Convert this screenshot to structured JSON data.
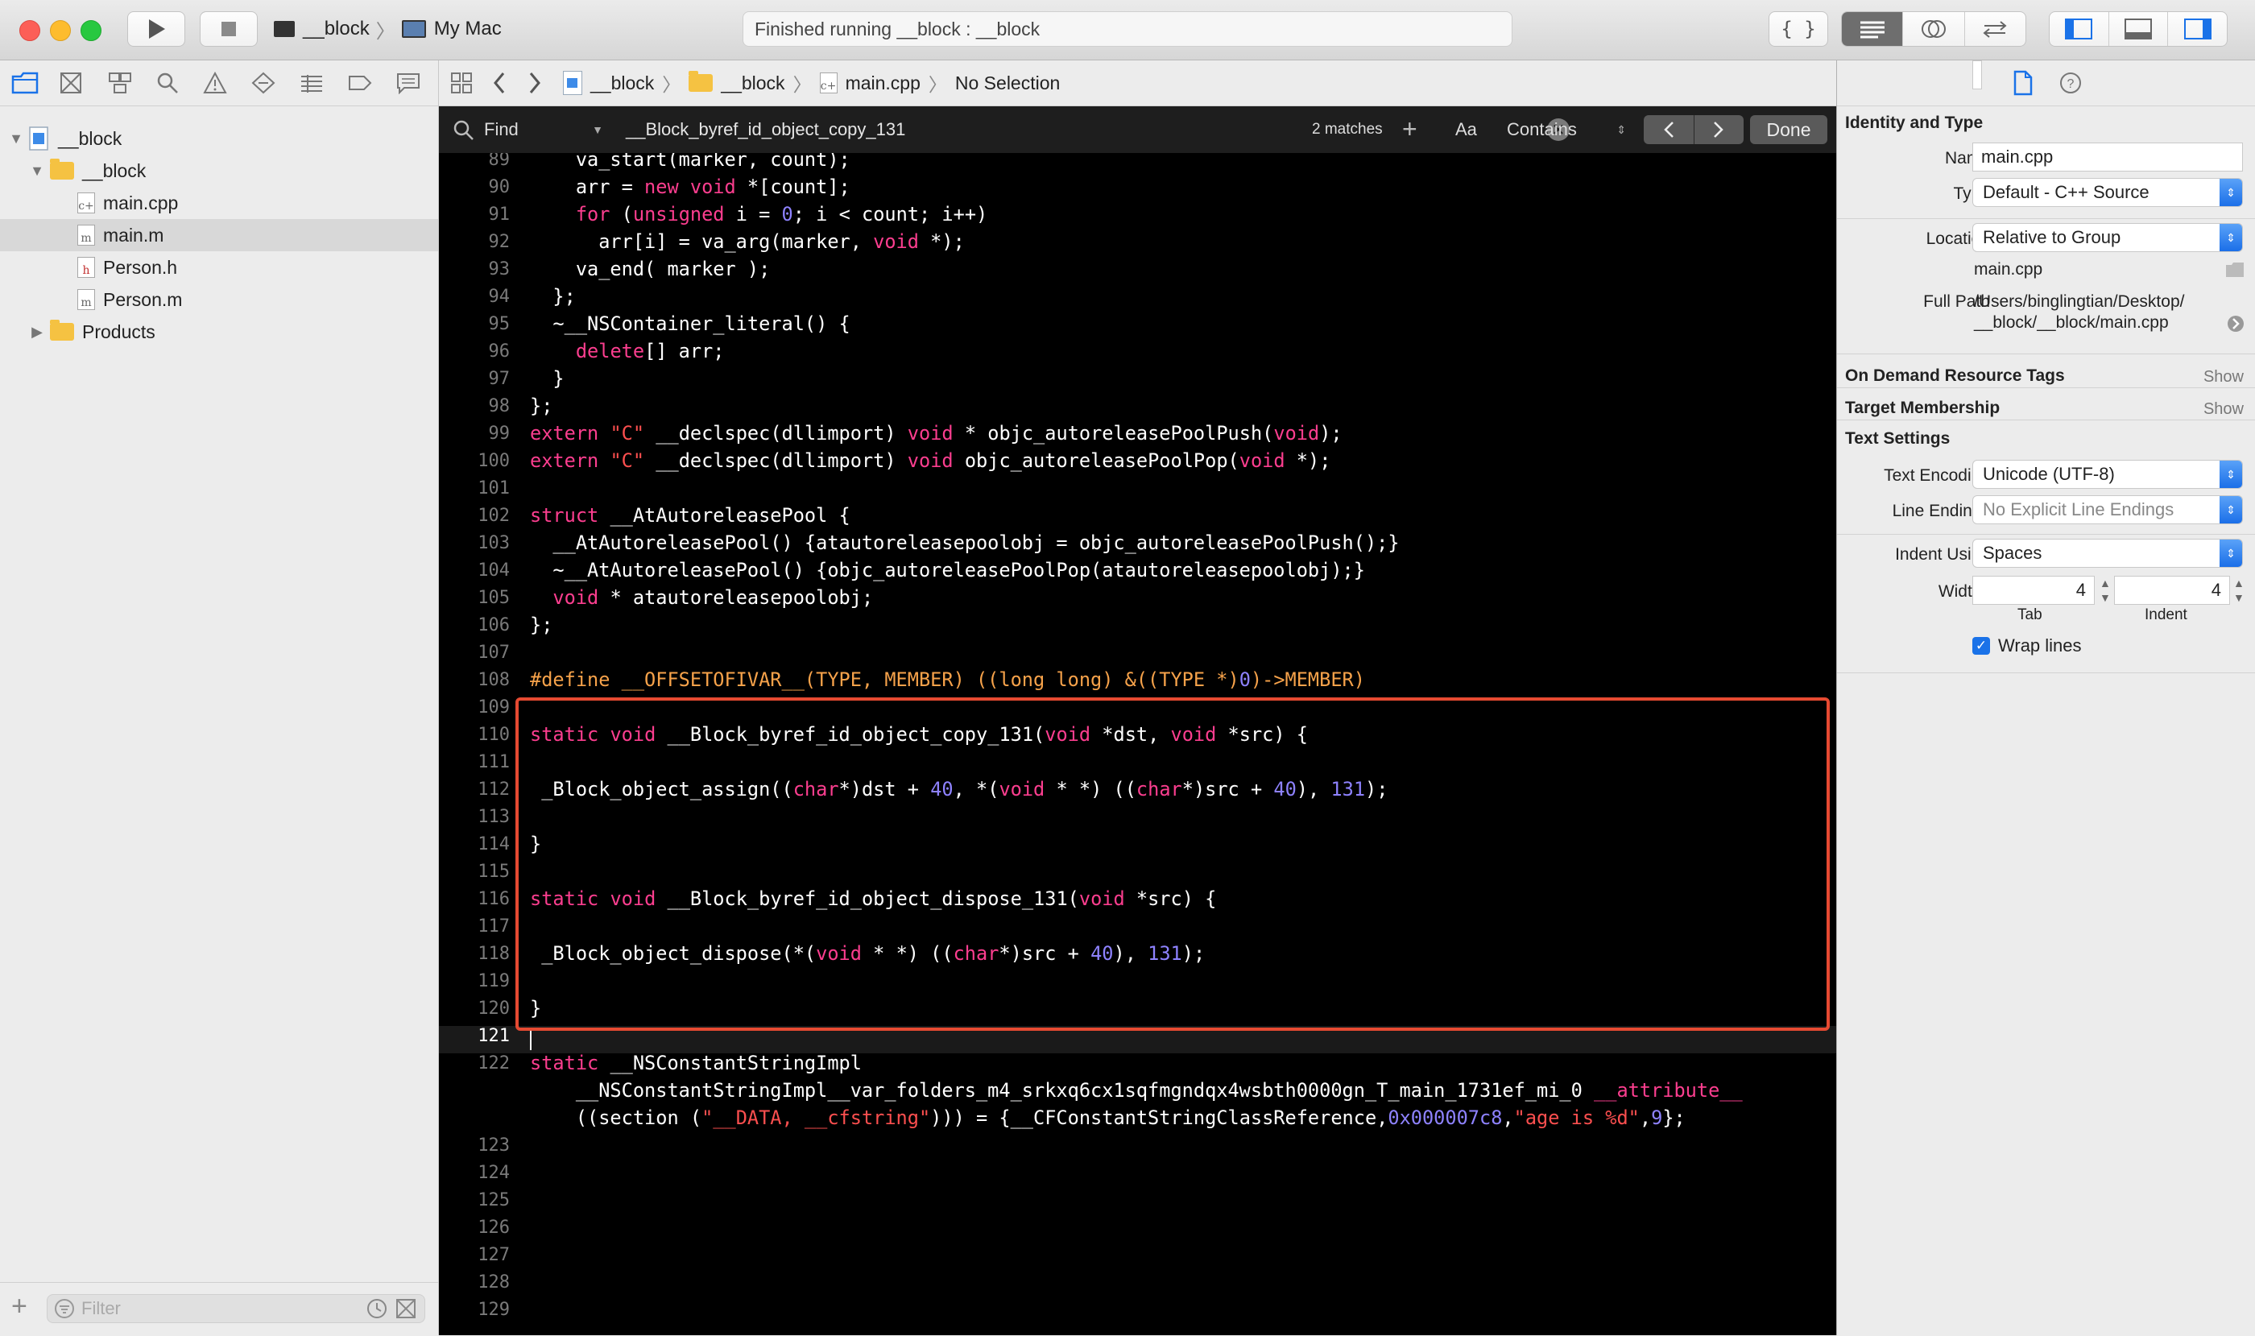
{
  "toolbar": {
    "scheme_target": "__block",
    "scheme_device": "My Mac",
    "activity_text": "Finished running __block : __block",
    "braces_label": "{ }"
  },
  "navigator": {
    "project": "__block",
    "group": "__block",
    "files": [
      "main.cpp",
      "main.m",
      "Person.h",
      "Person.m"
    ],
    "file_badges": [
      "c+",
      "m",
      "h",
      "m"
    ],
    "products": "Products",
    "filter_placeholder": "Filter"
  },
  "jumpbar": {
    "crumbs": [
      "__block",
      "__block",
      "main.cpp",
      "No Selection"
    ]
  },
  "find": {
    "mode": "Find",
    "query": "__Block_byref_id_object_copy_131",
    "matches": "2 matches",
    "case_label": "Aa",
    "match_type": "Contains",
    "done": "Done"
  },
  "editor": {
    "line_numbers": [
      "89",
      "90",
      "91",
      "92",
      "93",
      "94",
      "95",
      "96",
      "97",
      "98",
      "99",
      "100",
      "101",
      "102",
      "103",
      "104",
      "105",
      "106",
      "107",
      "108",
      "109",
      "110",
      "111",
      "112",
      "113",
      "114",
      "115",
      "116",
      "117",
      "118",
      "119",
      "120",
      "121",
      "122",
      "",
      "",
      "123",
      "124",
      "125",
      "126",
      "127",
      "128",
      "129"
    ]
  },
  "inspector": {
    "identity_title": "Identity and Type",
    "name_label": "Name",
    "name_value": "main.cpp",
    "type_label": "Type",
    "type_value": "Default - C++ Source",
    "location_label": "Location",
    "location_value": "Relative to Group",
    "location_file": "main.cpp",
    "fullpath_label": "Full Path",
    "fullpath_line1": "/Users/binglingtian/Desktop/",
    "fullpath_line2": "__block/__block/main.cpp",
    "odr_title": "On Demand Resource Tags",
    "target_title": "Target Membership",
    "show": "Show",
    "text_settings_title": "Text Settings",
    "encoding_label": "Text Encoding",
    "encoding_value": "Unicode (UTF-8)",
    "line_endings_label": "Line Endings",
    "line_endings_value": "No Explicit Line Endings",
    "indent_using_label": "Indent Using",
    "indent_using_value": "Spaces",
    "widths_label": "Widths",
    "tab_value": "4",
    "indent_value": "4",
    "tab_caption": "Tab",
    "indent_caption": "Indent",
    "wrap_lines": "Wrap lines"
  },
  "colors": {
    "keyword": "#fc3e8f",
    "number": "#8e82ff",
    "string": "#fc4f4f",
    "preprocessor": "#f6a24a",
    "highlight_box": "#e64a32"
  }
}
